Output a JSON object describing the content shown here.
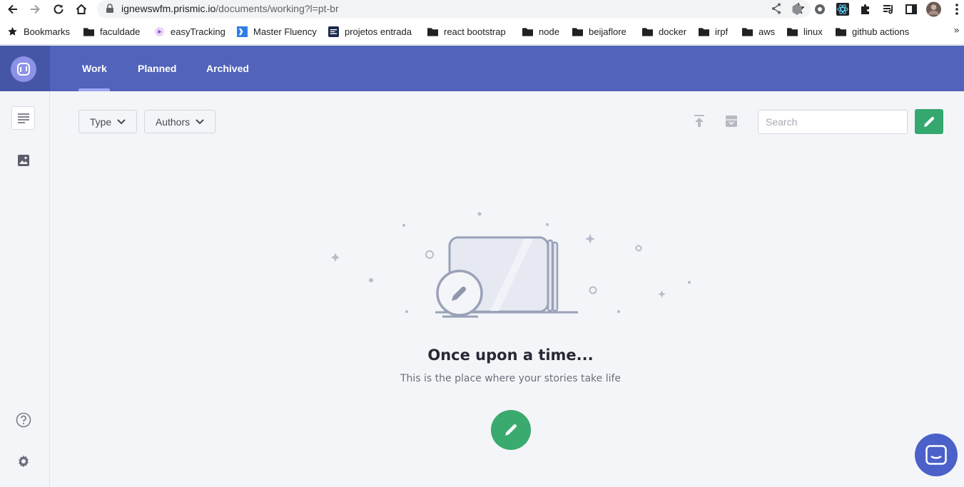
{
  "browser": {
    "url_host": "ignewswfm.prismic.io",
    "url_path": "/documents/working?l=pt-br",
    "bookmarks": [
      {
        "label": "Bookmarks",
        "icon": "star-icon"
      },
      {
        "label": "faculdade",
        "icon": "folder-icon"
      },
      {
        "label": "easyTracking",
        "icon": "favicon"
      },
      {
        "label": "Master Fluency",
        "icon": "favicon"
      },
      {
        "label": "projetos entrada",
        "icon": "favicon"
      },
      {
        "label": "react bootstrap",
        "icon": "folder-icon"
      },
      {
        "label": "node",
        "icon": "folder-icon"
      },
      {
        "label": "beijaflore",
        "icon": "folder-icon"
      },
      {
        "label": "docker",
        "icon": "folder-icon"
      },
      {
        "label": "irpf",
        "icon": "folder-icon"
      },
      {
        "label": "aws",
        "icon": "folder-icon"
      },
      {
        "label": "linux",
        "icon": "folder-icon"
      },
      {
        "label": "github actions",
        "icon": "folder-icon"
      }
    ],
    "more": "»"
  },
  "app": {
    "tabs": [
      {
        "label": "Work",
        "active": true
      },
      {
        "label": "Planned",
        "active": false
      },
      {
        "label": "Archived",
        "active": false
      }
    ],
    "filters": {
      "type_label": "Type",
      "authors_label": "Authors"
    },
    "search": {
      "placeholder": "Search",
      "value": ""
    },
    "empty_state": {
      "title": "Once upon a time...",
      "subtitle": "This is the place where your stories take life"
    },
    "colors": {
      "header": "#5163ba",
      "accent_green": "#34a86f",
      "chat": "#4b61c9"
    }
  }
}
